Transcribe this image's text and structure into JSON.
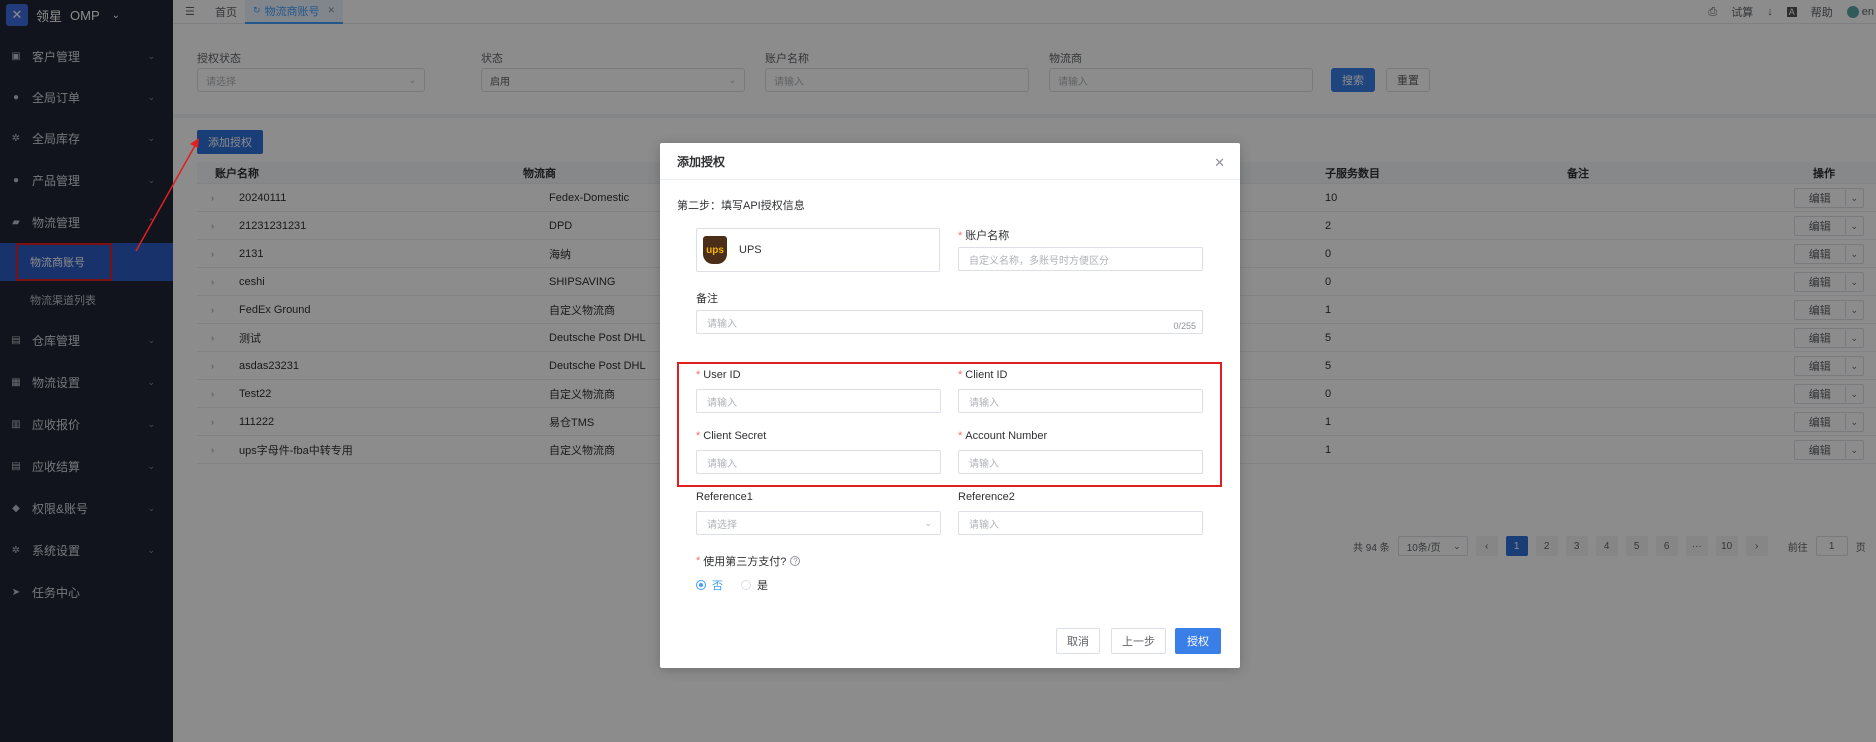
{
  "brand": {
    "name": "领星",
    "product": "OMP"
  },
  "sidebar": {
    "items": [
      {
        "label": "客户管理",
        "icon": "user-card-icon"
      },
      {
        "label": "全局订单",
        "icon": "user-icon"
      },
      {
        "label": "全局库存",
        "icon": "gear-icon"
      },
      {
        "label": "产品管理",
        "icon": "user-icon"
      },
      {
        "label": "物流管理",
        "icon": "truck-icon"
      },
      {
        "label": "仓库管理",
        "icon": "warehouse-icon"
      },
      {
        "label": "物流设置",
        "icon": "settings-box-icon"
      },
      {
        "label": "应收报价",
        "icon": "quote-icon"
      },
      {
        "label": "应收结算",
        "icon": "settlement-icon"
      },
      {
        "label": "权限&账号",
        "icon": "shield-icon"
      },
      {
        "label": "系统设置",
        "icon": "gear-icon"
      },
      {
        "label": "任务中心",
        "icon": "send-icon"
      }
    ],
    "sub_items": [
      {
        "label": "物流商账号",
        "active": true
      },
      {
        "label": "物流渠道列表",
        "active": false
      }
    ]
  },
  "topbar": {
    "tabs": [
      {
        "label": "首页"
      },
      {
        "label": "物流商账号"
      }
    ],
    "right": {
      "trial": "试算",
      "help": "帮助",
      "user": "en"
    }
  },
  "filters": {
    "auth_status_label": "授权状态",
    "auth_status_placeholder": "请选择",
    "status_label": "状态",
    "status_value": "启用",
    "account_label": "账户名称",
    "account_placeholder": "请输入",
    "carrier_label": "物流商",
    "carrier_placeholder": "请输入",
    "search": "搜索",
    "reset": "重置"
  },
  "content": {
    "add_button": "添加授权",
    "columns": {
      "account": "账户名称",
      "carrier": "物流商",
      "sub_count": "子服务数目",
      "remark": "备注",
      "ops": "操作"
    },
    "rows": [
      {
        "account": "20240111",
        "carrier": "Fedex-Domestic",
        "sub_count": "10"
      },
      {
        "account": "21231231231",
        "carrier": "DPD",
        "sub_count": "2"
      },
      {
        "account": "2131",
        "carrier": "海纳",
        "sub_count": "0"
      },
      {
        "account": "ceshi",
        "carrier": "SHIPSAVING",
        "sub_count": "0"
      },
      {
        "account": "FedEx Ground",
        "carrier": "自定义物流商",
        "sub_count": "1"
      },
      {
        "account": "测试",
        "carrier": "Deutsche Post DHL",
        "sub_count": "5"
      },
      {
        "account": "asdas23231",
        "carrier": "Deutsche Post DHL",
        "sub_count": "5"
      },
      {
        "account": "Test22",
        "carrier": "自定义物流商",
        "sub_count": "0"
      },
      {
        "account": "111222",
        "carrier": "易仓TMS",
        "sub_count": "1"
      },
      {
        "account": "ups字母件-fba中转专用",
        "carrier": "自定义物流商",
        "sub_count": "1"
      }
    ],
    "edit_label": "编辑",
    "pagination": {
      "total": "共 94 条",
      "page_size": "10条/页",
      "pages": [
        "1",
        "2",
        "3",
        "4",
        "5",
        "6",
        "···",
        "10"
      ],
      "goto": "前往",
      "goto_value": "1",
      "page_suffix": "页"
    }
  },
  "modal": {
    "title": "添加授权",
    "step": "第二步：填写API授权信息",
    "carrier_name": "UPS",
    "carrier_logo_text": "ups",
    "account_name_label": "账户名称",
    "account_name_placeholder": "自定义名称，多账号时方便区分",
    "remark_label": "备注",
    "remark_placeholder": "请输入",
    "remark_count": "0/255",
    "user_id_label": "User ID",
    "client_id_label": "Client ID",
    "client_secret_label": "Client Secret",
    "account_number_label": "Account Number",
    "input_placeholder": "请输入",
    "reference1_label": "Reference1",
    "reference1_placeholder": "请选择",
    "reference2_label": "Reference2",
    "reference2_placeholder": "请输入",
    "third_party_label": "使用第三方支付?",
    "option_no": "否",
    "option_yes": "是",
    "cancel": "取消",
    "prev": "上一步",
    "authorize": "授权"
  }
}
